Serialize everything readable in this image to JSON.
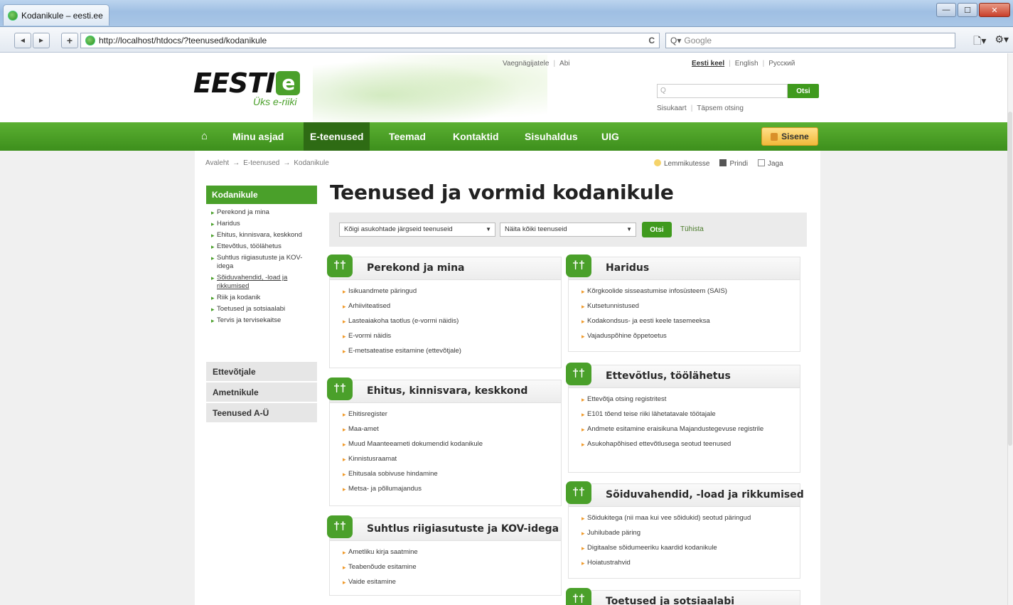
{
  "browser": {
    "tab_title": "Kodanikule – eesti.ee",
    "url": "http://localhost/htdocs/?teenused/kodanikule",
    "search_placeholder": "Google",
    "back": "◄",
    "forward": "►",
    "add": "+",
    "reload": "C",
    "search_prefix": "Q▾"
  },
  "header": {
    "logo_text": "EESTI",
    "logo_tagline": "Üks e-riiki",
    "top_links": [
      "Vaegnägijatele",
      "Abi"
    ],
    "languages": [
      "Eesti keel",
      "English",
      "Русский"
    ],
    "search_placeholder": "Q",
    "search_button": "Otsi",
    "sub_links": [
      "Sisukaart",
      "Täpsem otsing"
    ]
  },
  "mainnav": {
    "items": [
      "Minu asjad",
      "E-teenused",
      "Teemad",
      "Kontaktid",
      "Sisuhaldus",
      "UIG"
    ],
    "active": "E-teenused",
    "signin": "Sisene"
  },
  "breadcrumb": [
    "Avaleht",
    "E-teenused",
    "Kodanikule"
  ],
  "breadcrumb_sep": "→",
  "tools": [
    "Lemmikutesse",
    "Prindi",
    "Jaga"
  ],
  "sidebar": {
    "heading": "Kodanikule",
    "items": [
      "Perekond ja mina",
      "Haridus",
      "Ehitus, kinnisvara, keskkond",
      "Ettevõtlus, töölähetus",
      "Suhtlus riigiasutuste ja KOV-idega",
      "Sõiduvahendid, -load ja rikkumised",
      "Riik ja kodanik",
      "Toetused ja sotsiaalabi",
      "Tervis ja tervisekaitse"
    ],
    "blocks": [
      "Ettevõtjale",
      "Ametnikule",
      "Teenused A-Ü"
    ]
  },
  "main": {
    "title": "Teenused ja vormid kodanikule",
    "filter_select_1": "Kõigi asukohtade järgseid teenuseid",
    "filter_select_2": "Näita kõiki teenuseid",
    "filter_button": "Otsi",
    "filter_clear": "Tühista"
  },
  "cards": {
    "perekond": {
      "title": "Perekond ja mina",
      "items": [
        "Isikuandmete päringud",
        "Arhiiviteatised",
        "Lasteaiakoha taotlus (e-vormi näidis)",
        "E-vormi näidis",
        "E-metsateatise esitamine (ettevõtjale)"
      ]
    },
    "ehitus": {
      "title": "Ehitus, kinnisvara, keskkond",
      "items": [
        "Ehitisregister",
        "Maa-amet",
        "Muud Maanteeameti dokumendid kodanikule",
        "Kinnistusraamat",
        "Ehitusala sobivuse hindamine",
        "Metsa- ja põllumajandus"
      ]
    },
    "suhtlus": {
      "title": "Suhtlus riigiasutuste ja KOV-idega",
      "items": [
        "Ametliku kirja saatmine",
        "Teabenõude esitamine",
        "Vaide esitamine"
      ]
    },
    "haridus": {
      "title": "Haridus",
      "items": [
        "Kõrgkoolide sisseastumise infosüsteem (SAIS)",
        "Kutsetunnistused",
        "Kodakondsus- ja eesti keele tasemeeksa",
        "Vajaduspõhine õppetoetus"
      ]
    },
    "ettevotlus": {
      "title": "Ettevõtlus, töölähetus",
      "items": [
        "Ettevõtja otsing registritest",
        "E101 tõend teise riiki lähetatavale töötajale",
        "Andmete esitamine eraisikuna Majandustegevuse registrile",
        "Asukohapõhised ettevõtlusega seotud teenused"
      ]
    },
    "soiduvahendid": {
      "title": "Sõiduvahendid, -load ja rikkumised",
      "items": [
        "Sõidukitega (nii maa kui vee sõidukid) seotud päringud",
        "Juhilubade päring",
        "Digitaalse sõidumeeriku kaardid kodanikule",
        "Hoiatustrahvid"
      ]
    },
    "toetused": {
      "title": "Toetused ja sotsiaalabi"
    }
  },
  "colors": {
    "brand_green": "#4aa02a",
    "nav_green": "#3d8f1c",
    "bullet_orange": "#f09a2a"
  }
}
